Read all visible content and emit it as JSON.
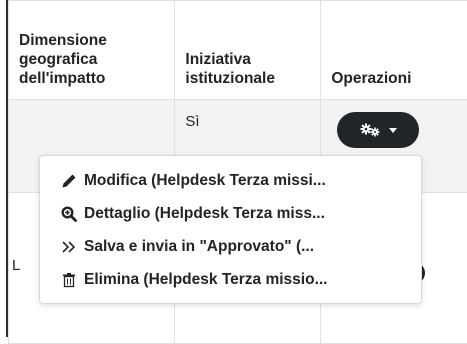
{
  "table": {
    "headers": {
      "col1": "Dimensione geografica dell'impatto",
      "col2": "Iniziativa istituzionale",
      "col3": "Operazioni"
    },
    "rows": [
      {
        "col1": "",
        "col2": "Sì"
      },
      {
        "col1": "L",
        "col2": ""
      }
    ]
  },
  "operations_button": {
    "icon": "gears-icon"
  },
  "dropdown": {
    "items": [
      {
        "icon": "pencil-icon",
        "label": "Modifica (Helpdesk Terza missi..."
      },
      {
        "icon": "search-plus-icon",
        "label": "Dettaglio (Helpdesk Terza miss..."
      },
      {
        "icon": "double-chevron-right-icon",
        "label": "Salva e invia in \"Approvato\" (..."
      },
      {
        "icon": "trash-icon",
        "label": "Elimina (Helpdesk Terza missio..."
      }
    ]
  }
}
